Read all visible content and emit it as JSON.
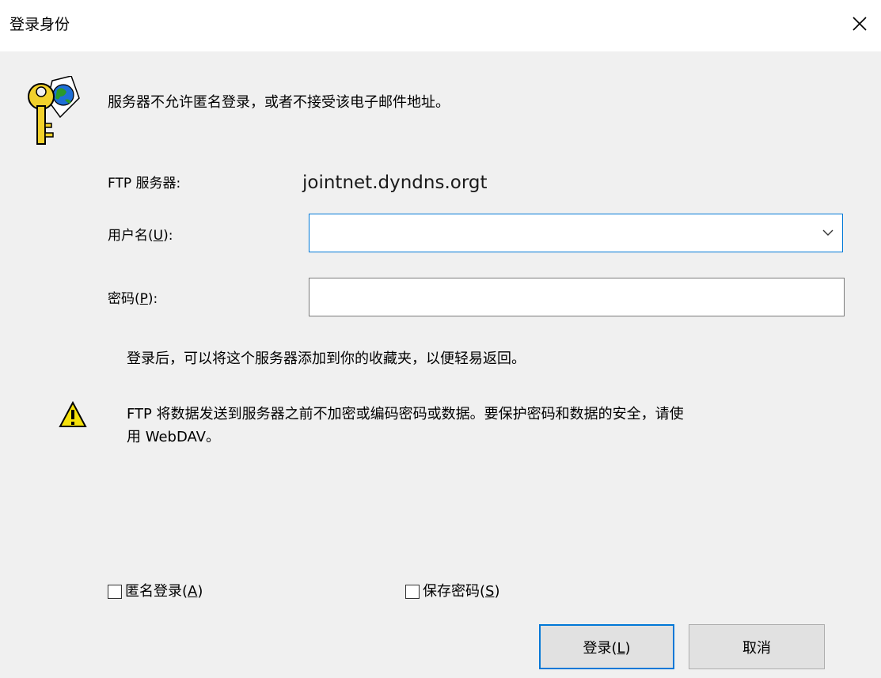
{
  "window": {
    "title": "登录身份"
  },
  "message": "服务器不允许匿名登录，或者不接受该电子邮件地址。",
  "server": {
    "label": "FTP 服务器:",
    "value": "jointnet.dyndns.orgt"
  },
  "username": {
    "label_prefix": "用户名(",
    "label_key": "U",
    "label_suffix": "):",
    "value": ""
  },
  "password": {
    "label_prefix": "密码(",
    "label_key": "P",
    "label_suffix": "):",
    "value": ""
  },
  "info_text": "登录后，可以将这个服务器添加到你的收藏夹，以便轻易返回。",
  "warning_line1": "FTP 将数据发送到服务器之前不加密或编码密码或数据。要保护密码和数据的安全，请使",
  "warning_line2": "用 WebDAV。",
  "anonymous": {
    "label_prefix": "匿名登录(",
    "label_key": "A",
    "label_suffix": ")",
    "checked": false
  },
  "save_password": {
    "label_prefix": "保存密码(",
    "label_key": "S",
    "label_suffix": ")",
    "checked": false
  },
  "buttons": {
    "login": {
      "label_prefix": "登录(",
      "label_key": "L",
      "label_suffix": ")"
    },
    "cancel": {
      "label": "取消"
    }
  },
  "colors": {
    "accent": "#0078d7",
    "background": "#f0f0f0",
    "titlebar": "#ffffff"
  },
  "icons": [
    "key-globe-icon",
    "warning-icon",
    "close-icon",
    "chevron-down-icon"
  ]
}
